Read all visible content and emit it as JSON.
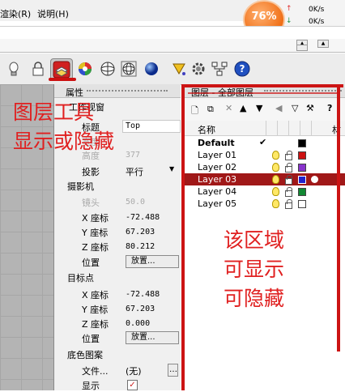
{
  "menu": {
    "item1": "渲染(R)",
    "item2": "说明(H)"
  },
  "perf": {
    "cpu": "76%",
    "up": "0K/s",
    "down": "0K/s"
  },
  "toolbar": {
    "icons": [
      "bulb-icon",
      "lock-icon",
      "layers-icon",
      "color-wheel-icon",
      "sphere-icon",
      "globe-icon",
      "grid-sphere-icon",
      "blue-sphere-icon",
      "cone-icon",
      "gear-icon",
      "network-icon",
      "help-icon"
    ]
  },
  "properties": {
    "title": "属性",
    "section_view": "工作视窗",
    "title_label": "标题",
    "title_value": "Top",
    "width_label": "宽度",
    "height_label": "高度",
    "height_value": "377",
    "projection_label": "投影",
    "projection_value": "平行",
    "section_camera": "摄影机",
    "lens_label": "镜头",
    "lens_value": "50.0",
    "cam_x_label": "X 座标",
    "cam_x_value": "-72.488",
    "cam_y_label": "Y 座标",
    "cam_y_value": "67.203",
    "cam_z_label": "Z 座标",
    "cam_z_value": "80.212",
    "position_label": "位置",
    "place_button": "放置...",
    "section_target": "目标点",
    "tgt_x_label": "X 座标",
    "tgt_x_value": "-72.488",
    "tgt_y_label": "Y 座标",
    "tgt_y_value": "67.203",
    "tgt_z_label": "Z 座标",
    "tgt_z_value": "0.000",
    "tgt_position_label": "位置",
    "tgt_place_button": "放置...",
    "section_background": "底色图案",
    "file_label": "文件...",
    "file_value": "(无)",
    "show_label": "显示"
  },
  "layers": {
    "title": "图层 - 全部图层",
    "col_name": "名称",
    "col_material": "材",
    "rows": [
      {
        "name": "Default",
        "color": "#000000",
        "current": true
      },
      {
        "name": "Layer 01",
        "color": "#cc1111"
      },
      {
        "name": "Layer 02",
        "color": "#8833cc"
      },
      {
        "name": "Layer 03",
        "color": "#2222cc",
        "selected": true
      },
      {
        "name": "Layer 04",
        "color": "#118833"
      },
      {
        "name": "Layer 05",
        "color": "#ffffff"
      }
    ]
  },
  "annotations": {
    "toolbar_note_line1": "图层工具",
    "toolbar_note_line2": "显示或隐藏",
    "area_note_line1": "该区域",
    "area_note_line2": "可显示",
    "area_note_line3": "可隐藏"
  }
}
